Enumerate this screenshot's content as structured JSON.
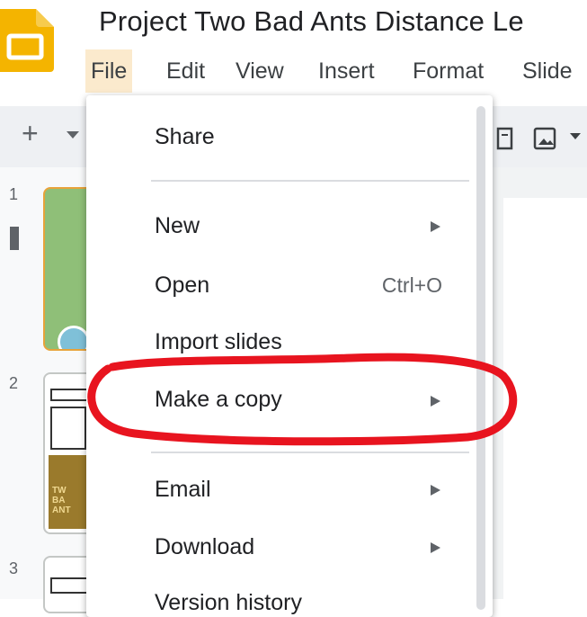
{
  "app": {
    "title": "Project Two Bad Ants Distance Le",
    "icon": "slides-logo-icon",
    "brand_color": "#f4b400"
  },
  "menubar": {
    "items": [
      {
        "label": "File",
        "active": true
      },
      {
        "label": "Edit"
      },
      {
        "label": "View"
      },
      {
        "label": "Insert"
      },
      {
        "label": "Format"
      },
      {
        "label": "Slide"
      }
    ]
  },
  "toolbar": {
    "icons": [
      "plus-icon",
      "chevron-down-icon",
      "textbox-icon",
      "image-icon",
      "chevron-down-icon"
    ]
  },
  "filmstrip": {
    "slide_numbers": [
      "1",
      "2",
      "3"
    ],
    "slide2_title_lines": [
      "TW",
      "BA",
      "ANT"
    ]
  },
  "file_menu": {
    "share": "Share",
    "new": "New",
    "open": "Open",
    "open_shortcut": "Ctrl+O",
    "import_slides": "Import slides",
    "make_a_copy": "Make a copy",
    "email": "Email",
    "download": "Download",
    "cutoff_item": "Version history"
  },
  "annotation": {
    "highlight_color": "#e8141f",
    "target": "Make a copy"
  }
}
